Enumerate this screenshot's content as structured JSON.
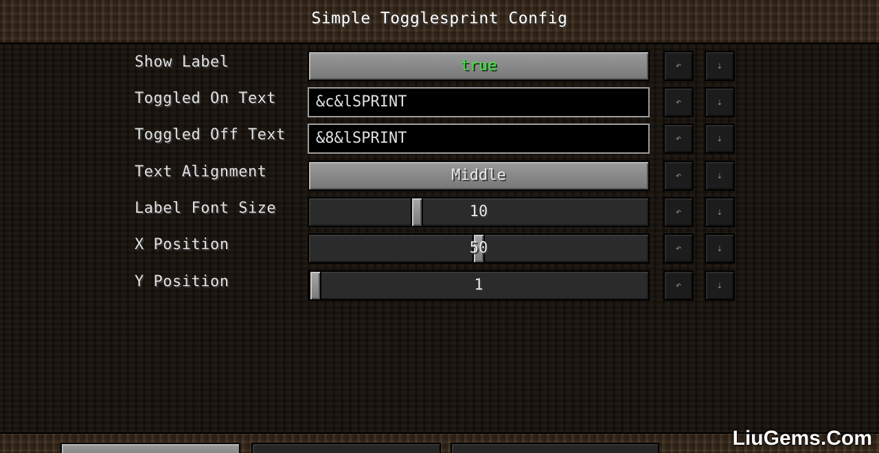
{
  "window": {
    "title": "Simple Togglesprint Config"
  },
  "options": [
    {
      "label": "Show Label",
      "type": "toggle",
      "value": "true",
      "value_color": "#3fe03f"
    },
    {
      "label": "Toggled On Text",
      "type": "text",
      "value": "&c&lSPRINT"
    },
    {
      "label": "Toggled Off Text",
      "type": "text",
      "value": "&8&lSPRINT"
    },
    {
      "label": "Text Alignment",
      "type": "cycle",
      "value": "Middle"
    },
    {
      "label": "Label Font Size",
      "type": "slider",
      "value": "10",
      "fraction": 0.31
    },
    {
      "label": "X Position",
      "type": "slider",
      "value": "50",
      "fraction": 0.5
    },
    {
      "label": "Y Position",
      "type": "slider",
      "value": "1",
      "fraction": 0.0
    }
  ],
  "row_actions": {
    "undo_icon": "↶",
    "reset_icon": "⇣"
  },
  "footer_buttons": [
    {
      "name": "done-button",
      "style": "light"
    },
    {
      "name": "undo-changes-button",
      "style": "dark"
    },
    {
      "name": "reset-to-default-button",
      "style": "dark"
    }
  ],
  "watermark": "LiuGems.Com",
  "colors": {
    "accent_true": "#3fe03f",
    "text": "#e0e0e0"
  }
}
